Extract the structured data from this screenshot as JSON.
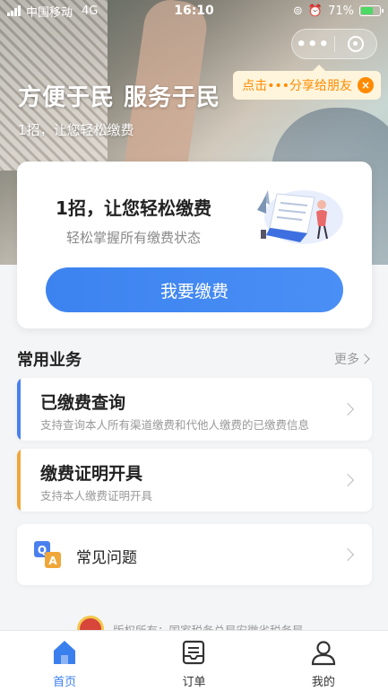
{
  "status_bar": {
    "carrier": "中国移动",
    "network": "4G",
    "time": "16:10",
    "battery_percent": "71%",
    "battery_level": 0.71
  },
  "capsule": {
    "more_label": "•••"
  },
  "share_tip": {
    "text": "点击•••分享给朋友",
    "close": "×"
  },
  "hero": {
    "title": "方便于民 服务于民",
    "subtitle": "1招，让您轻松缴费"
  },
  "main_card": {
    "title": "1招，让您轻松缴费",
    "subtitle": "轻松掌握所有缴费状态",
    "button_label": "我要缴费"
  },
  "common_services": {
    "title": "常用业务",
    "more_label": "更多",
    "items": [
      {
        "name": "已缴费查询",
        "desc": "支持查询本人所有渠道缴费和代他人缴费的已缴费信息",
        "accent": "#4a80ee"
      },
      {
        "name": "缴费证明开具",
        "desc": "支持本人缴费证明开具",
        "accent": "#f0a73a"
      }
    ]
  },
  "faq": {
    "label": "常见问题"
  },
  "footer": {
    "copyright": "版权所有：国家税务总局安徽省税务局"
  },
  "tab_bar": {
    "tabs": [
      {
        "label": "首页",
        "icon": "home-icon",
        "active": true
      },
      {
        "label": "订单",
        "icon": "order-icon",
        "active": false
      },
      {
        "label": "我的",
        "icon": "profile-icon",
        "active": false
      }
    ]
  },
  "colors": {
    "primary": "#3d83f0",
    "accent_orange": "#ff8a00",
    "tab_active": "#3a7fee"
  }
}
